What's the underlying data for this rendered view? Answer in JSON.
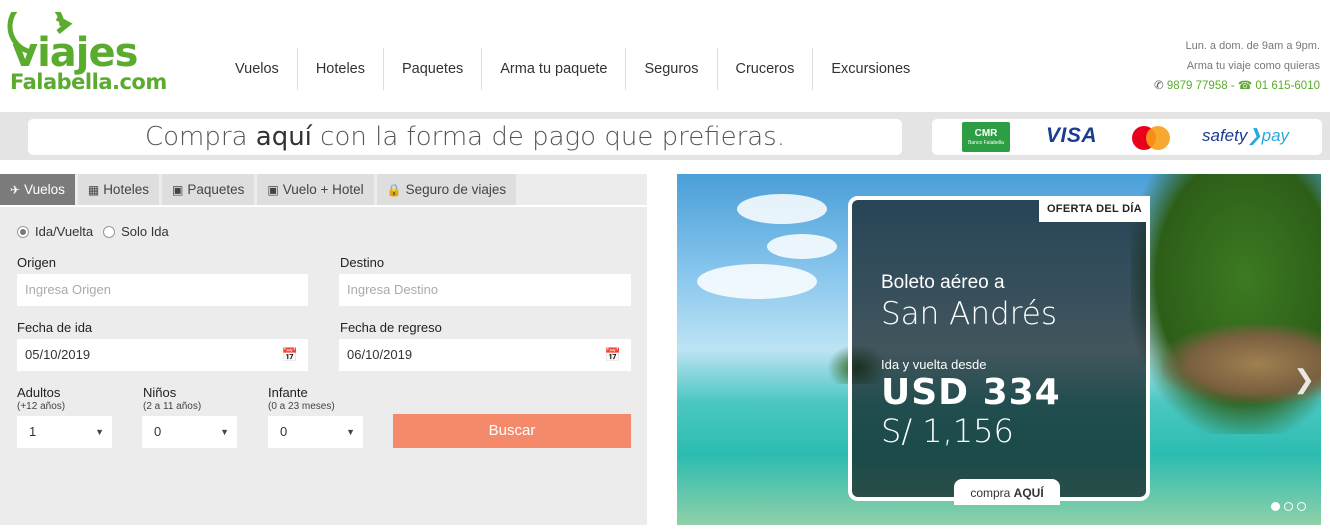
{
  "logo": {
    "line1": "viajes",
    "line2": "Falabella.com"
  },
  "nav": [
    "Vuelos",
    "Hoteles",
    "Paquetes",
    "Arma tu paquete",
    "Seguros",
    "Cruceros",
    "Excursiones"
  ],
  "contact": {
    "hours": "Lun. a dom. de 9am a 9pm.",
    "tagline": "Arma tu viaje como quieras",
    "whatsapp": "9879 77958",
    "separator": "-",
    "phone": "01 615-6010"
  },
  "banner": {
    "pre": "Compra ",
    "bold": "aquí",
    "post": " con la forma de pago que prefieras."
  },
  "payment": {
    "cmr": "CMR",
    "cmr_sub": "Banco Falabella",
    "visa": "VISA",
    "safety1": "safety",
    "safety2": "pay"
  },
  "tabs": [
    {
      "label": "Vuelos",
      "icon": "plane-icon"
    },
    {
      "label": "Hoteles",
      "icon": "building-icon"
    },
    {
      "label": "Paquetes",
      "icon": "suitcase-icon"
    },
    {
      "label": "Vuelo + Hotel",
      "icon": "suitcase-icon"
    },
    {
      "label": "Seguro de viajes",
      "icon": "lock-icon"
    }
  ],
  "trip": {
    "roundtrip": "Ida/Vuelta",
    "oneway": "Solo Ida"
  },
  "form": {
    "origen_label": "Origen",
    "origen_placeholder": "Ingresa Origen",
    "destino_label": "Destino",
    "destino_placeholder": "Ingresa Destino",
    "ida_label": "Fecha de ida",
    "ida_value": "05/10/2019",
    "regreso_label": "Fecha de regreso",
    "regreso_value": "06/10/2019",
    "adultos_label": "Adultos",
    "adultos_sub": "(+12 años)",
    "adultos_value": "1",
    "ninos_label": "Niños",
    "ninos_sub": "(2 a 11 años)",
    "ninos_value": "0",
    "infante_label": "Infante",
    "infante_sub": "(0 a 23 meses)",
    "infante_value": "0",
    "search_button": "Buscar"
  },
  "offer": {
    "tag": "OFERTA DEL DÍA",
    "line1": "Boleto aéreo a",
    "line2": "San Andrés",
    "line3": "Ida y vuelta desde",
    "usd": "USD 334",
    "soles": "S/ 1,156",
    "cta_pre": "compra ",
    "cta_bold": "AQUÍ"
  },
  "colors": {
    "brand_green": "#5aab2e",
    "search_button": "#f48a6a",
    "tab_active": "#7b7b7b"
  }
}
